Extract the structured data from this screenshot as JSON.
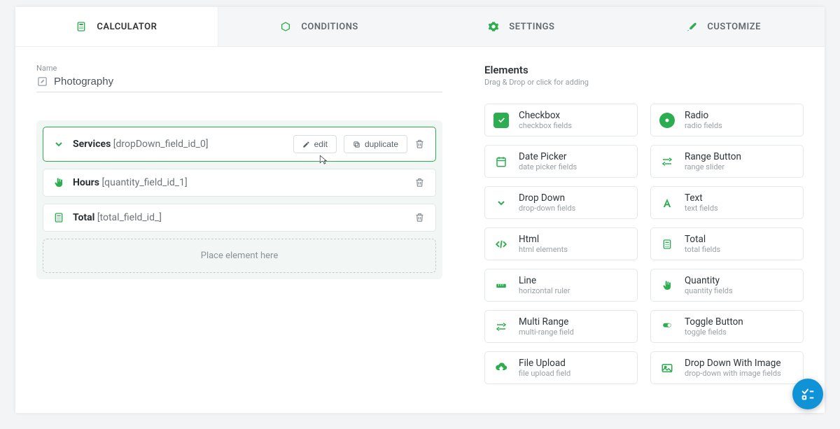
{
  "tabs": [
    {
      "label": "CALCULATOR",
      "icon": "calculator",
      "active": true
    },
    {
      "label": "CONDITIONS",
      "icon": "cube",
      "active": false
    },
    {
      "label": "SETTINGS",
      "icon": "gear",
      "active": false
    },
    {
      "label": "CUSTOMIZE",
      "icon": "brush",
      "active": false
    }
  ],
  "name_label": "Name",
  "name_value": "Photography",
  "fields": [
    {
      "icon": "chevron",
      "title": "Services",
      "meta": "[dropDown_field_id_0]",
      "selected": true,
      "show_actions": true
    },
    {
      "icon": "hand",
      "title": "Hours",
      "meta": "[quantity_field_id_1]",
      "selected": false,
      "show_actions": false
    },
    {
      "icon": "calc",
      "title": "Total",
      "meta": "[total_field_id_]",
      "selected": false,
      "show_actions": false
    }
  ],
  "edit_label": "edit",
  "duplicate_label": "duplicate",
  "placeholder_text": "Place element here",
  "elements_heading": "Elements",
  "elements_subheading": "Drag & Drop or click for adding",
  "elements": [
    {
      "title": "Checkbox",
      "desc": "checkbox fields",
      "icon": "check-filled"
    },
    {
      "title": "Radio",
      "desc": "radio fields",
      "icon": "radio-circle"
    },
    {
      "title": "Date Picker",
      "desc": "date picker fields",
      "icon": "calendar"
    },
    {
      "title": "Range Button",
      "desc": "range slider",
      "icon": "range"
    },
    {
      "title": "Drop Down",
      "desc": "drop-down fields",
      "icon": "chevron"
    },
    {
      "title": "Text",
      "desc": "text fields",
      "icon": "text-a"
    },
    {
      "title": "Html",
      "desc": "html elements",
      "icon": "code"
    },
    {
      "title": "Total",
      "desc": "total fields",
      "icon": "calc"
    },
    {
      "title": "Line",
      "desc": "horizontal ruler",
      "icon": "ruler"
    },
    {
      "title": "Quantity",
      "desc": "quantity fields",
      "icon": "hand"
    },
    {
      "title": "Multi Range",
      "desc": "multi-range field",
      "icon": "range"
    },
    {
      "title": "Toggle Button",
      "desc": "toggle fields",
      "icon": "toggle"
    },
    {
      "title": "File Upload",
      "desc": "file upload field",
      "icon": "upload"
    },
    {
      "title": "Drop Down With Image",
      "desc": "drop-down with image fields",
      "icon": "image"
    }
  ]
}
